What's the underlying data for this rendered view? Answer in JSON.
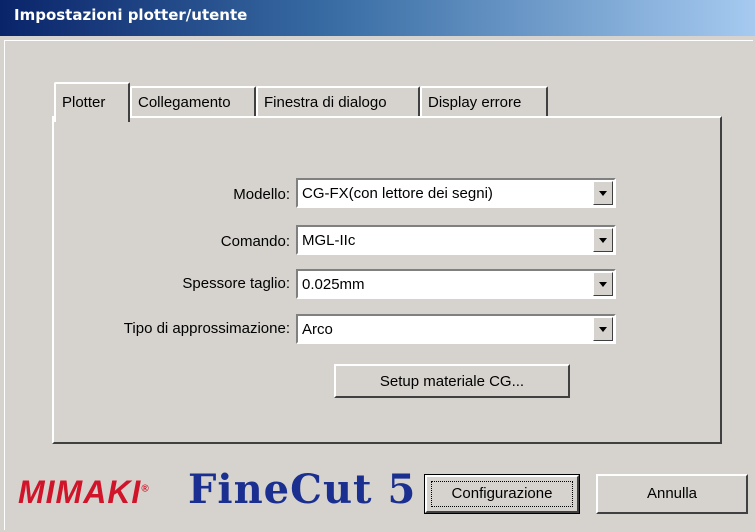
{
  "window": {
    "title": "Impostazioni plotter/utente"
  },
  "tabs": [
    {
      "label": "Plotter",
      "active": true
    },
    {
      "label": "Collegamento",
      "active": false
    },
    {
      "label": "Finestra di dialogo",
      "active": false
    },
    {
      "label": "Display errore",
      "active": false
    }
  ],
  "form": {
    "modello": {
      "label": "Modello:",
      "value": "CG-FX(con lettore dei segni)"
    },
    "comando": {
      "label": "Comando:",
      "value": "MGL-IIc"
    },
    "spessore": {
      "label": "Spessore taglio:",
      "value": "0.025mm"
    },
    "tipo": {
      "label": "Tipo di approssimazione:",
      "value": "Arco"
    },
    "setup_button": "Setup materiale CG..."
  },
  "footer": {
    "logo_mimaki": "MIMAKI",
    "logo_finecut": "FineCut 5",
    "config_button": "Configurazione",
    "cancel_button": "Annulla"
  },
  "colors": {
    "title_gradient_start": "#0a246a",
    "title_gradient_end": "#a6caf0",
    "mimaki_red": "#d0142a",
    "finecut_blue": "#1a2f8f"
  }
}
